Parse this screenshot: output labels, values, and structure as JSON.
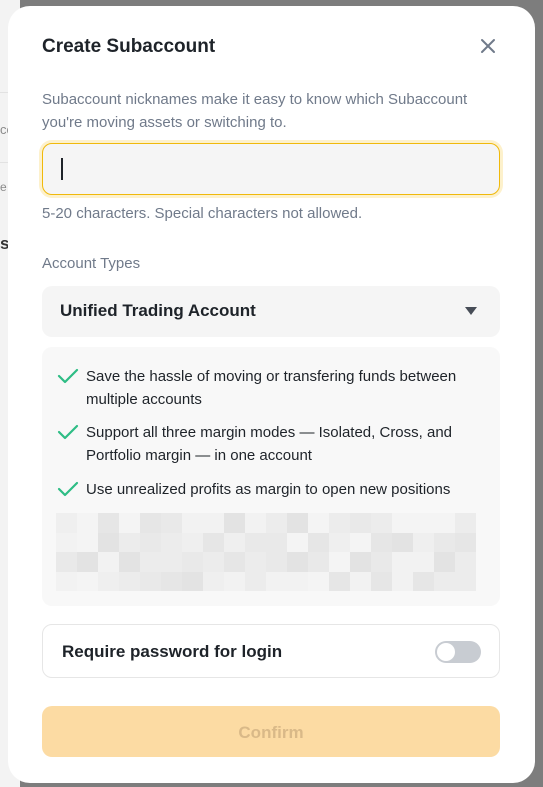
{
  "background_fragments": [
    "co",
    "e",
    "s"
  ],
  "modal": {
    "title": "Create Subaccount",
    "description": "Subaccount nicknames make it easy to know which Subaccount you're moving assets or switching to.",
    "nickname_input": {
      "value": "",
      "placeholder": ""
    },
    "hint": "5-20 characters. Special characters not allowed.",
    "account_types_label": "Account Types",
    "account_type_selected": "Unified Trading Account",
    "features": [
      {
        "icon": "check-icon",
        "text": "Save the hassle of moving or transfering funds between multiple accounts"
      },
      {
        "icon": "check-icon",
        "text": "Support all three margin modes — Isolated, Cross, and Portfolio margin — in one account"
      },
      {
        "icon": "check-icon",
        "text": "Use unrealized profits as margin to open new positions"
      }
    ],
    "require_password": {
      "label": "Require password for login",
      "enabled": false
    },
    "confirm_label": "Confirm"
  },
  "colors": {
    "accent": "#f0b90b",
    "check": "#2ebd85",
    "confirm_disabled_bg": "#fcdba3",
    "confirm_disabled_text": "#d9b988"
  }
}
